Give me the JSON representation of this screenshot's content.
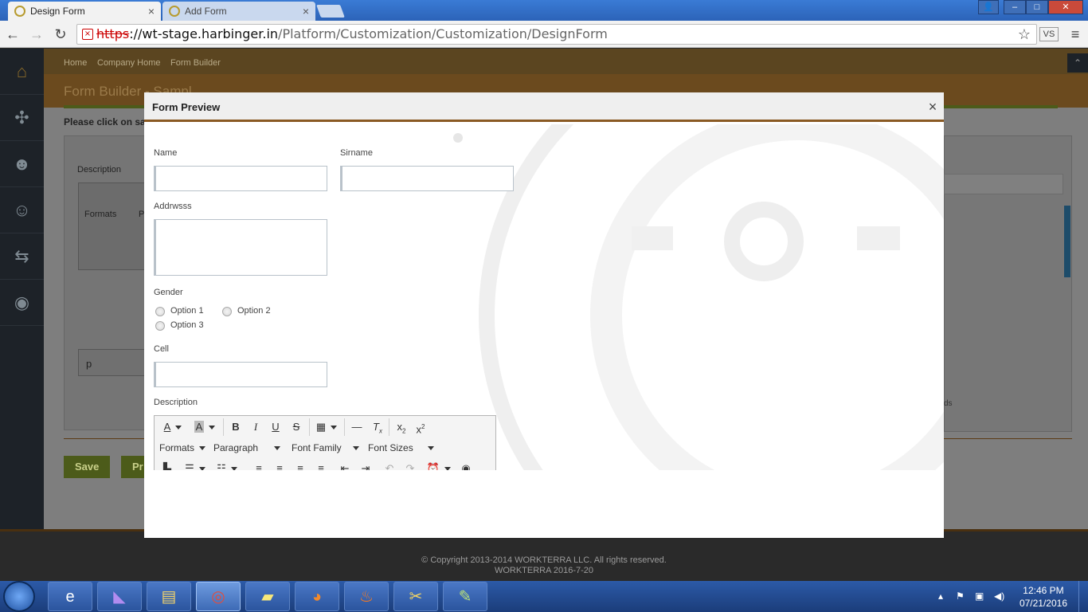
{
  "browser": {
    "tabs": [
      {
        "title": "Design Form",
        "active": true
      },
      {
        "title": "Add Form",
        "active": false
      }
    ],
    "url": {
      "scheme": "https",
      "host": "://wt-stage.harbinger.in",
      "path": "/Platform/Customization/Customization/DesignForm"
    },
    "window_controls": {
      "user": "👤",
      "minimize": "–",
      "maximize": "□",
      "close": "✕"
    }
  },
  "app": {
    "breadcrumb": [
      "Home",
      "Company Home",
      "Form Builder"
    ],
    "page_title": "Form Builder - Sampl",
    "instruction": "Please click on sav",
    "description_label": "Description",
    "buttons": {
      "save": "Save",
      "preview": "Pr"
    },
    "behind_editor": {
      "formats": "Formats",
      "para": "P",
      "status_p": "p",
      "right_snippet": "ds"
    },
    "sidebar_icons": [
      "home-icon",
      "puzzle-icon",
      "user-star-icon",
      "user-icon",
      "arrows-icon",
      "chat-icon"
    ]
  },
  "modal": {
    "title": "Form Preview",
    "close": "×",
    "fields": {
      "name_label": "Name",
      "sirname_label": "Sirname",
      "address_label": "Addrwsss",
      "gender_label": "Gender",
      "option1": "Option 1",
      "option2": "Option 2",
      "option3": "Option 3",
      "cell_label": "Cell",
      "description_label": "Description"
    },
    "editor": {
      "formats": "Formats",
      "paragraph": "Paragraph",
      "font_family": "Font Family",
      "font_sizes": "Font Sizes"
    }
  },
  "footer": {
    "copyright": "© Copyright 2013-2014 WORKTERRA LLC. All rights reserved.",
    "version": "WORKTERRA 2016-7-20"
  },
  "taskbar": {
    "time": "12:46 PM",
    "date": "07/21/2016",
    "apps": [
      "ie-icon",
      "visual-studio-icon",
      "explorer-icon",
      "chrome-icon",
      "sticky-notes-icon",
      "firefox-icon",
      "flame-icon",
      "snipping-tool-icon",
      "notepad-icon"
    ]
  },
  "colors": {
    "accent_brown": "#8a5a23",
    "save_green": "#4c5b1a",
    "sidebar": "#1d2228"
  }
}
